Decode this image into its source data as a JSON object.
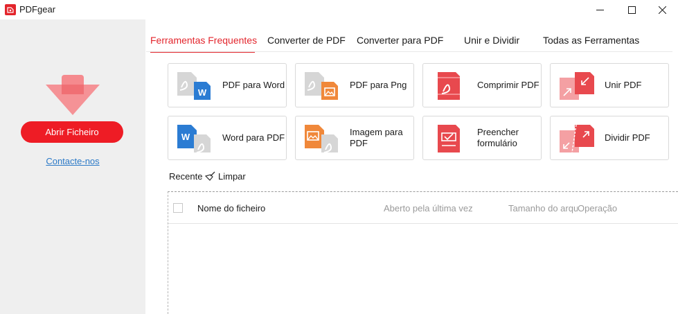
{
  "app": {
    "title": "PDFgear"
  },
  "sidebar": {
    "open_button": "Abrir Ficheiro",
    "contact_link": "Contacte-nos"
  },
  "tabs": [
    {
      "label": "Ferramentas Frequentes",
      "active": true
    },
    {
      "label": "Converter de PDF",
      "active": false
    },
    {
      "label": "Converter para PDF",
      "active": false
    },
    {
      "label": "Unir e Dividir",
      "active": false
    },
    {
      "label": "Todas as Ferramentas",
      "active": false
    }
  ],
  "tools": [
    {
      "label": "PDF para Word",
      "icon": "pdf-to-word-icon"
    },
    {
      "label": "PDF para Png",
      "icon": "pdf-to-png-icon"
    },
    {
      "label": "Comprimir PDF",
      "icon": "compress-pdf-icon"
    },
    {
      "label": "Unir PDF",
      "icon": "merge-pdf-icon"
    },
    {
      "label": "Word para PDF",
      "icon": "word-to-pdf-icon"
    },
    {
      "label": "Imagem para PDF",
      "icon": "image-to-pdf-icon"
    },
    {
      "label": "Preencher formulário",
      "icon": "fill-form-icon"
    },
    {
      "label": "Dividir PDF",
      "icon": "split-pdf-icon"
    }
  ],
  "recent": {
    "label": "Recente",
    "clear": "Limpar",
    "columns": {
      "name": "Nome do ficheiro",
      "opened": "Aberto pela última vez",
      "size": "Tamanho do arquivo",
      "operation": "Operação"
    }
  },
  "colors": {
    "accent": "#e3252c",
    "button": "#ee1c25",
    "link": "#2b79c7",
    "word_blue": "#2b7cd3",
    "image_orange": "#f0883a"
  }
}
